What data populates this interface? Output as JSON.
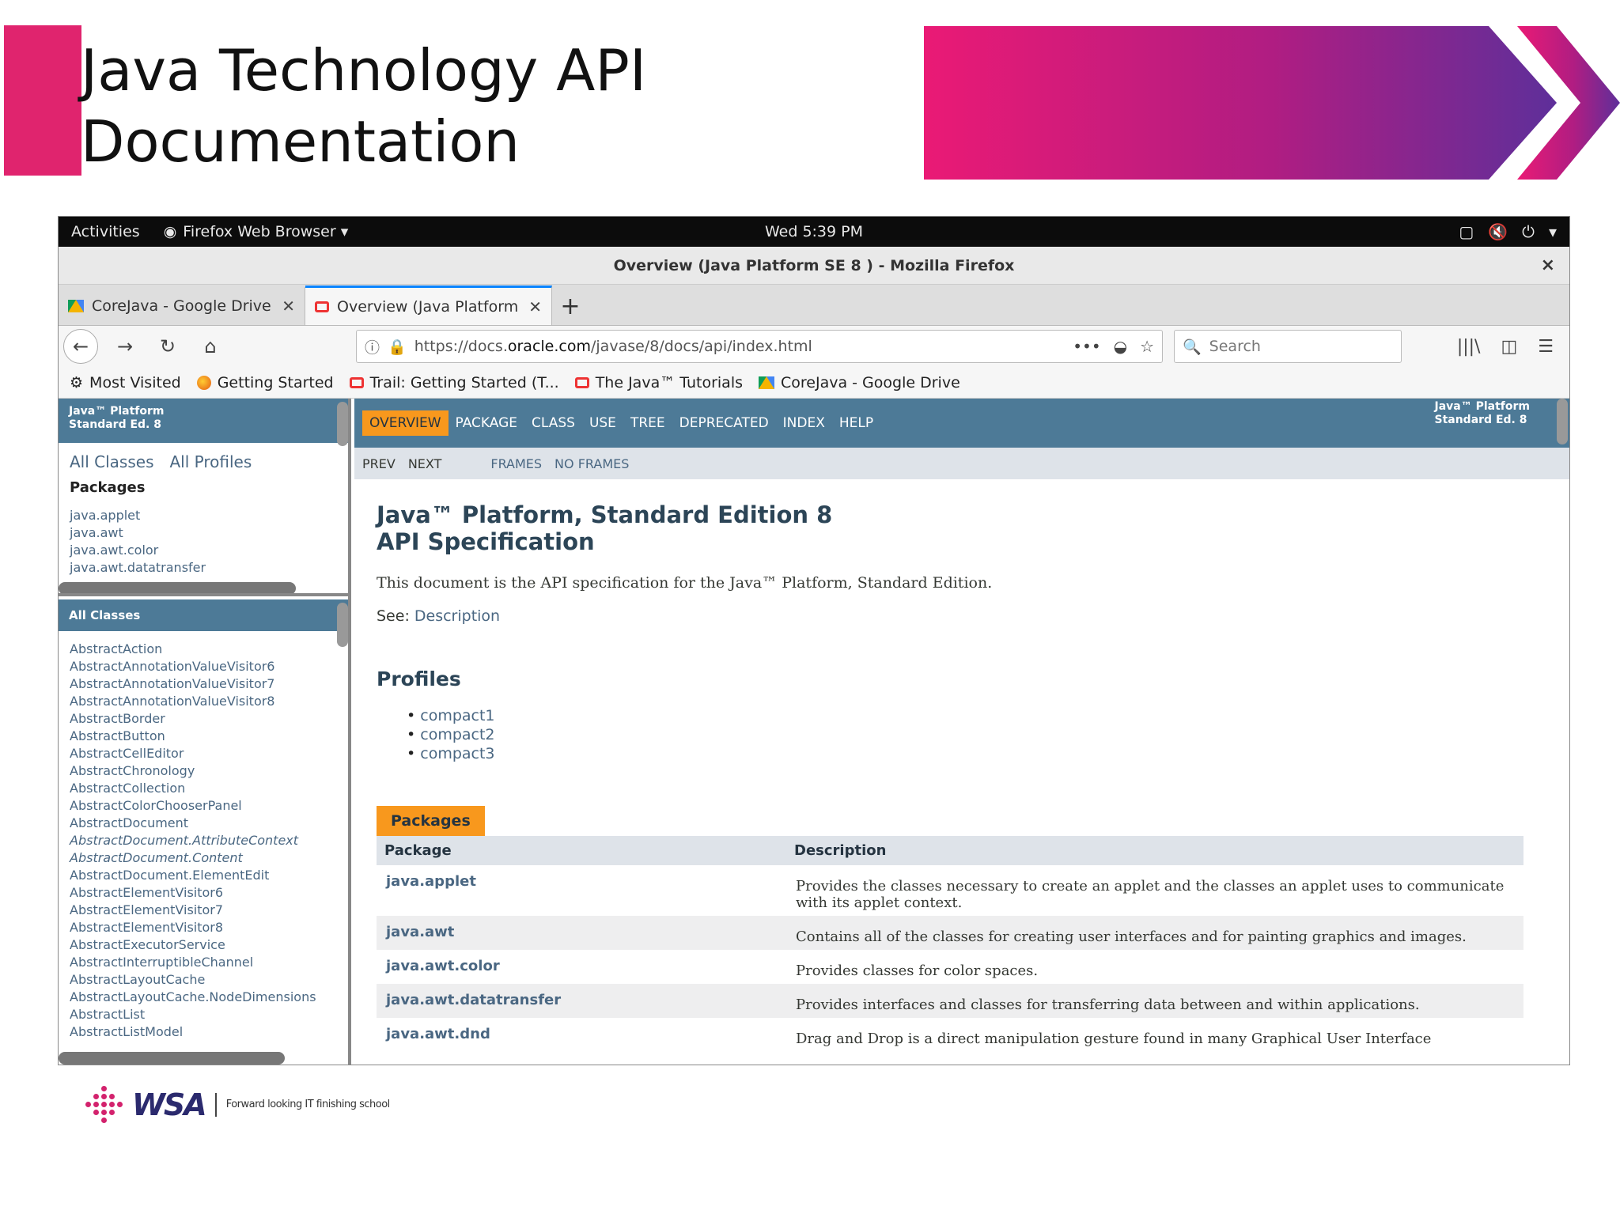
{
  "slide": {
    "title": "Java Technology API\nDocumentation",
    "accent_color": "#e0246e"
  },
  "gnome": {
    "activities": "Activities",
    "app": "Firefox Web Browser ▾",
    "clock": "Wed  5:39 PM"
  },
  "window": {
    "title": "Overview (Java Platform SE 8 ) - Mozilla Firefox"
  },
  "tabs": [
    {
      "label": "CoreJava - Google Drive"
    },
    {
      "label": "Overview (Java Platform"
    }
  ],
  "navbar": {
    "url_prefix": "https://docs.",
    "url_domain": "oracle.com",
    "url_path": "/javase/8/docs/api/index.html",
    "search_placeholder": "Search"
  },
  "bookmarks": [
    "Most Visited",
    "Getting Started",
    "Trail: Getting Started (T...",
    "The Java™ Tutorials",
    "CoreJava - Google Drive"
  ],
  "left": {
    "header": "Java™ Platform\nStandard Ed. 8",
    "all_classes": "All Classes",
    "all_profiles": "All Profiles",
    "packages_heading": "Packages",
    "packages": [
      "java.applet",
      "java.awt",
      "java.awt.color",
      "java.awt.datatransfer"
    ],
    "classes_header": "All Classes",
    "classes": [
      "AbstractAction",
      "AbstractAnnotationValueVisitor6",
      "AbstractAnnotationValueVisitor7",
      "AbstractAnnotationValueVisitor8",
      "AbstractBorder",
      "AbstractButton",
      "AbstractCellEditor",
      "AbstractChronology",
      "AbstractCollection",
      "AbstractColorChooserPanel",
      "AbstractDocument",
      "AbstractDocument.AttributeContext",
      "AbstractDocument.Content",
      "AbstractDocument.ElementEdit",
      "AbstractElementVisitor6",
      "AbstractElementVisitor7",
      "AbstractElementVisitor8",
      "AbstractExecutorService",
      "AbstractInterruptibleChannel",
      "AbstractLayoutCache",
      "AbstractLayoutCache.NodeDimensions",
      "AbstractList",
      "AbstractListModel"
    ]
  },
  "main": {
    "topnav": [
      "OVERVIEW",
      "PACKAGE",
      "CLASS",
      "USE",
      "TREE",
      "DEPRECATED",
      "INDEX",
      "HELP"
    ],
    "about": "Java™ Platform\nStandard Ed. 8",
    "subnav": [
      "PREV",
      "NEXT",
      "FRAMES",
      "NO FRAMES"
    ],
    "title_line1": "Java™ Platform, Standard Edition 8",
    "title_line2": "API Specification",
    "lead": "This document is the API specification for the Java™ Platform, Standard Edition.",
    "see_label": "See:",
    "see_link": "Description",
    "profiles_heading": "Profiles",
    "profiles": [
      "compact1",
      "compact2",
      "compact3"
    ],
    "packages_caption": "Packages",
    "table_headers": [
      "Package",
      "Description"
    ],
    "table_rows": [
      {
        "pkg": "java.applet",
        "desc": "Provides the classes necessary to create an applet and the classes an applet uses to communicate with its applet context."
      },
      {
        "pkg": "java.awt",
        "desc": "Contains all of the classes for creating user interfaces and for painting graphics and images."
      },
      {
        "pkg": "java.awt.color",
        "desc": "Provides classes for color spaces."
      },
      {
        "pkg": "java.awt.datatransfer",
        "desc": "Provides interfaces and classes for transferring data between and within applications."
      },
      {
        "pkg": "java.awt.dnd",
        "desc": "Drag and Drop is a direct manipulation gesture found in many Graphical User Interface"
      }
    ]
  },
  "footer": {
    "brand": "WSA",
    "tagline": "Forward looking IT finishing school"
  }
}
